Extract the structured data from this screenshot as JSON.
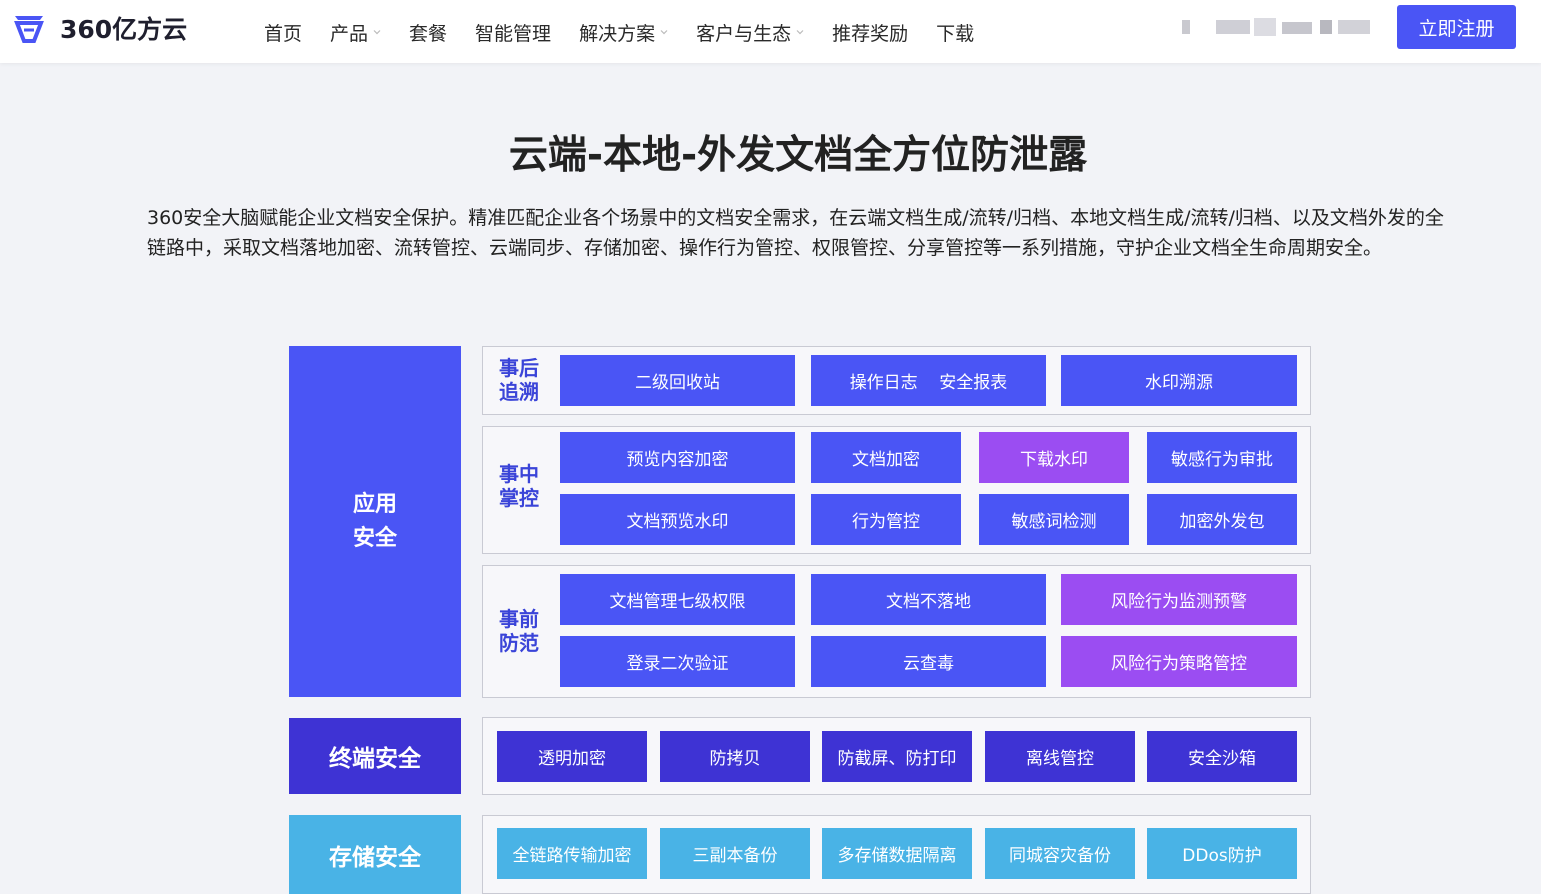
{
  "header": {
    "logo_text": "360亿方云",
    "nav": [
      {
        "label": "首页",
        "dropdown": false
      },
      {
        "label": "产品",
        "dropdown": true
      },
      {
        "label": "套餐",
        "dropdown": false
      },
      {
        "label": "智能管理",
        "dropdown": false
      },
      {
        "label": "解决方案",
        "dropdown": true
      },
      {
        "label": "客户与生态",
        "dropdown": true
      },
      {
        "label": "推荐奖励",
        "dropdown": false
      },
      {
        "label": "下载",
        "dropdown": false
      }
    ],
    "register_button": "立即注册"
  },
  "main": {
    "title": "云端-本地-外发文档全方位防泄露",
    "description": "360安全大脑赋能企业文档安全保护。精准匹配企业各个场景中的文档安全需求，在云端文档生成/流转/归档、本地文档生成/流转/归档、以及文档外发的全链路中，采取文档落地加密、流转管控、云端同步、存储加密、操作行为管控、权限管控、分享管控等一系列措施，守护企业文档全生命周期安全。"
  },
  "diagram": {
    "app_security": {
      "label_line1": "应用",
      "label_line2": "安全",
      "groups": {
        "after": {
          "label_line1": "事后",
          "label_line2": "追溯",
          "cells": [
            "二级回收站",
            "操作日志    安全报表",
            "水印溯源"
          ]
        },
        "during": {
          "label_line1": "事中",
          "label_line2": "掌控",
          "cells": [
            "预览内容加密",
            "文档加密",
            "下载水印",
            "敏感行为审批",
            "文档预览水印",
            "行为管控",
            "敏感词检测",
            "加密外发包"
          ]
        },
        "before": {
          "label_line1": "事前",
          "label_line2": "防范",
          "cells": [
            "文档管理七级权限",
            "文档不落地",
            "风险行为监测预警",
            "登录二次验证",
            "云查毒",
            "风险行为策略管控"
          ]
        }
      }
    },
    "terminal_security": {
      "label": "终端安全",
      "cells": [
        "透明加密",
        "防拷贝",
        "防截屏、防打印",
        "离线管控",
        "安全沙箱"
      ]
    },
    "storage_security": {
      "label": "存储安全",
      "cells": [
        "全链路传输加密",
        "三副本备份",
        "多存储数据隔离",
        "同城容灾备份",
        "DDos防护"
      ]
    },
    "colors": {
      "blue": "#4a55f5",
      "purple": "#9b4df2",
      "dark_indigo": "#3e33d4",
      "sky": "#49b3e6"
    }
  }
}
